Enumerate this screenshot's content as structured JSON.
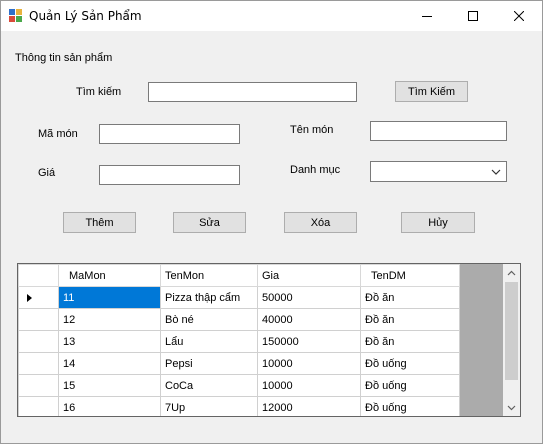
{
  "window": {
    "title": "Quản Lý Sản Phẩm",
    "accent": "#0078d7"
  },
  "form": {
    "group_label": "Thông tin sản phẩm",
    "search_label": "Tìm kiếm",
    "search_value": "",
    "search_button": "Tìm Kiếm",
    "ma_mon_label": "Mã món",
    "ma_mon_value": "",
    "ten_mon_label": "Tên món",
    "ten_mon_value": "",
    "gia_label": "Giá",
    "gia_value": "",
    "danh_muc_label": "Danh mục",
    "danh_muc_value": ""
  },
  "actions": {
    "add": "Thêm",
    "edit": "Sửa",
    "delete": "Xóa",
    "cancel": "Hủy"
  },
  "grid": {
    "columns": [
      "MaMon",
      "TenMon",
      "Gia",
      "TenDM"
    ],
    "rows": [
      [
        "11",
        "Pizza thập cẩm",
        "50000",
        "Đồ ăn"
      ],
      [
        "12",
        "Bò né",
        "40000",
        "Đồ ăn"
      ],
      [
        "13",
        "Lẩu",
        "150000",
        "Đồ ăn"
      ],
      [
        "14",
        "Pepsi",
        "10000",
        "Đồ uống"
      ],
      [
        "15",
        "CoCa",
        "10000",
        "Đồ uống"
      ],
      [
        "16",
        "7Up",
        "12000",
        "Đồ uống"
      ]
    ],
    "selected_row": 0
  }
}
